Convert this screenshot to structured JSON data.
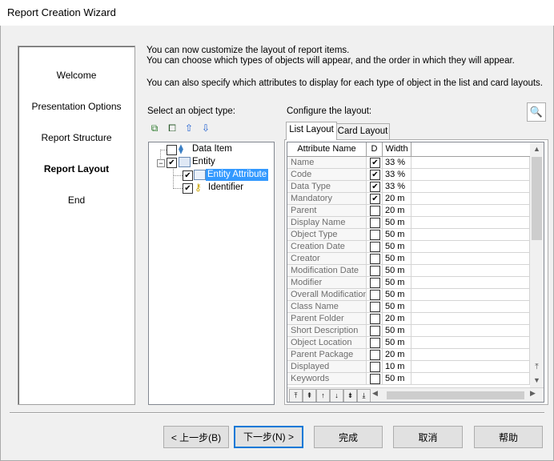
{
  "window": {
    "title": "Report Creation Wizard"
  },
  "steps": [
    {
      "label": "Welcome",
      "current": false
    },
    {
      "label": "Presentation Options",
      "current": false
    },
    {
      "label": "Report Structure",
      "current": false
    },
    {
      "label": "Report Layout",
      "current": true
    },
    {
      "label": "End",
      "current": false
    }
  ],
  "intro": {
    "line1": "You can now customize the layout of report items.",
    "line2": "You can choose which types of objects will appear, and the order in which they will appear.",
    "line3": "You can also specify which attributes to display for each type of object in the list and card layouts."
  },
  "object_type": {
    "label": "Select an object type:",
    "toolbar_icons": [
      "select-all-icon",
      "deselect-all-icon",
      "move-up-icon",
      "move-down-icon"
    ],
    "tree": [
      {
        "label": "Data Item",
        "checked": false,
        "icon": "data-item-icon",
        "level": 0
      },
      {
        "label": "Entity",
        "checked": true,
        "icon": "entity-icon",
        "level": 0
      },
      {
        "label": "Entity Attribute",
        "checked": true,
        "icon": "attribute-grid-icon",
        "level": 1,
        "selected": true
      },
      {
        "label": "Identifier",
        "checked": true,
        "icon": "identifier-key-icon",
        "level": 1
      }
    ]
  },
  "layout": {
    "label": "Configure the layout:",
    "tabs": [
      {
        "label": "List Layout",
        "active": true
      },
      {
        "label": "Card Layout",
        "active": false
      }
    ],
    "columns": {
      "attr": "Attribute Name",
      "d": "D",
      "width": "Width"
    },
    "rows": [
      {
        "name": "Name",
        "d": true,
        "width": "33 %"
      },
      {
        "name": "Code",
        "d": true,
        "width": "33 %"
      },
      {
        "name": "Data Type",
        "d": true,
        "width": "33 %"
      },
      {
        "name": "Mandatory",
        "d": true,
        "width": "20 m"
      },
      {
        "name": "Parent",
        "d": false,
        "width": "20 m"
      },
      {
        "name": "Display Name",
        "d": false,
        "width": "50 m"
      },
      {
        "name": "Object Type",
        "d": false,
        "width": "50 m"
      },
      {
        "name": "Creation Date",
        "d": false,
        "width": "50 m"
      },
      {
        "name": "Creator",
        "d": false,
        "width": "50 m"
      },
      {
        "name": "Modification Date",
        "d": false,
        "width": "50 m"
      },
      {
        "name": "Modifier",
        "d": false,
        "width": "50 m"
      },
      {
        "name": "Overall Modification",
        "d": false,
        "width": "50 m"
      },
      {
        "name": "Class Name",
        "d": false,
        "width": "50 m"
      },
      {
        "name": "Parent Folder",
        "d": false,
        "width": "20 m"
      },
      {
        "name": "Short Description",
        "d": false,
        "width": "50 m"
      },
      {
        "name": "Object Location",
        "d": false,
        "width": "50 m"
      },
      {
        "name": "Parent Package",
        "d": false,
        "width": "20 m"
      },
      {
        "name": "Displayed",
        "d": false,
        "width": "10 m"
      },
      {
        "name": "Keywords",
        "d": false,
        "width": "50 m"
      }
    ],
    "move_buttons": [
      "move-top-icon",
      "move-page-up-icon",
      "move-up-icon",
      "move-down-icon",
      "move-page-down-icon",
      "move-bottom-icon"
    ]
  },
  "buttons": {
    "back": "< 上一步(B)",
    "next": "下一步(N) >",
    "finish": "完成",
    "cancel": "取消",
    "help": "帮助"
  }
}
